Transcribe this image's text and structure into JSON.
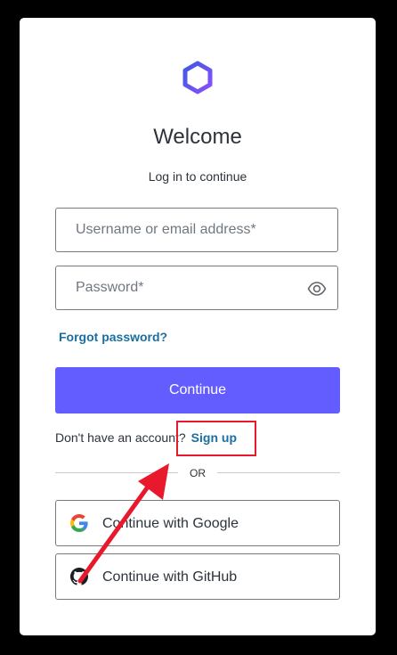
{
  "header": {
    "title": "Welcome",
    "subtitle": "Log in to continue",
    "logo_icon": "hexagon-logo-icon"
  },
  "form": {
    "username_placeholder": "Username or email address*",
    "username_value": "",
    "password_placeholder": "Password*",
    "password_value": "",
    "show_password_icon": "eye-icon",
    "forgot_password_label": "Forgot password?",
    "continue_label": "Continue"
  },
  "signup": {
    "prompt": "Don't have an account?",
    "link_label": "Sign up"
  },
  "divider": {
    "label": "OR"
  },
  "social": {
    "google_label": "Continue with Google",
    "google_icon": "google-icon",
    "github_label": "Continue with GitHub",
    "github_icon": "github-icon"
  },
  "colors": {
    "primary": "#635dff",
    "link": "#1a6fa0",
    "annotation": "#e8192c",
    "backdrop": "#000000"
  }
}
